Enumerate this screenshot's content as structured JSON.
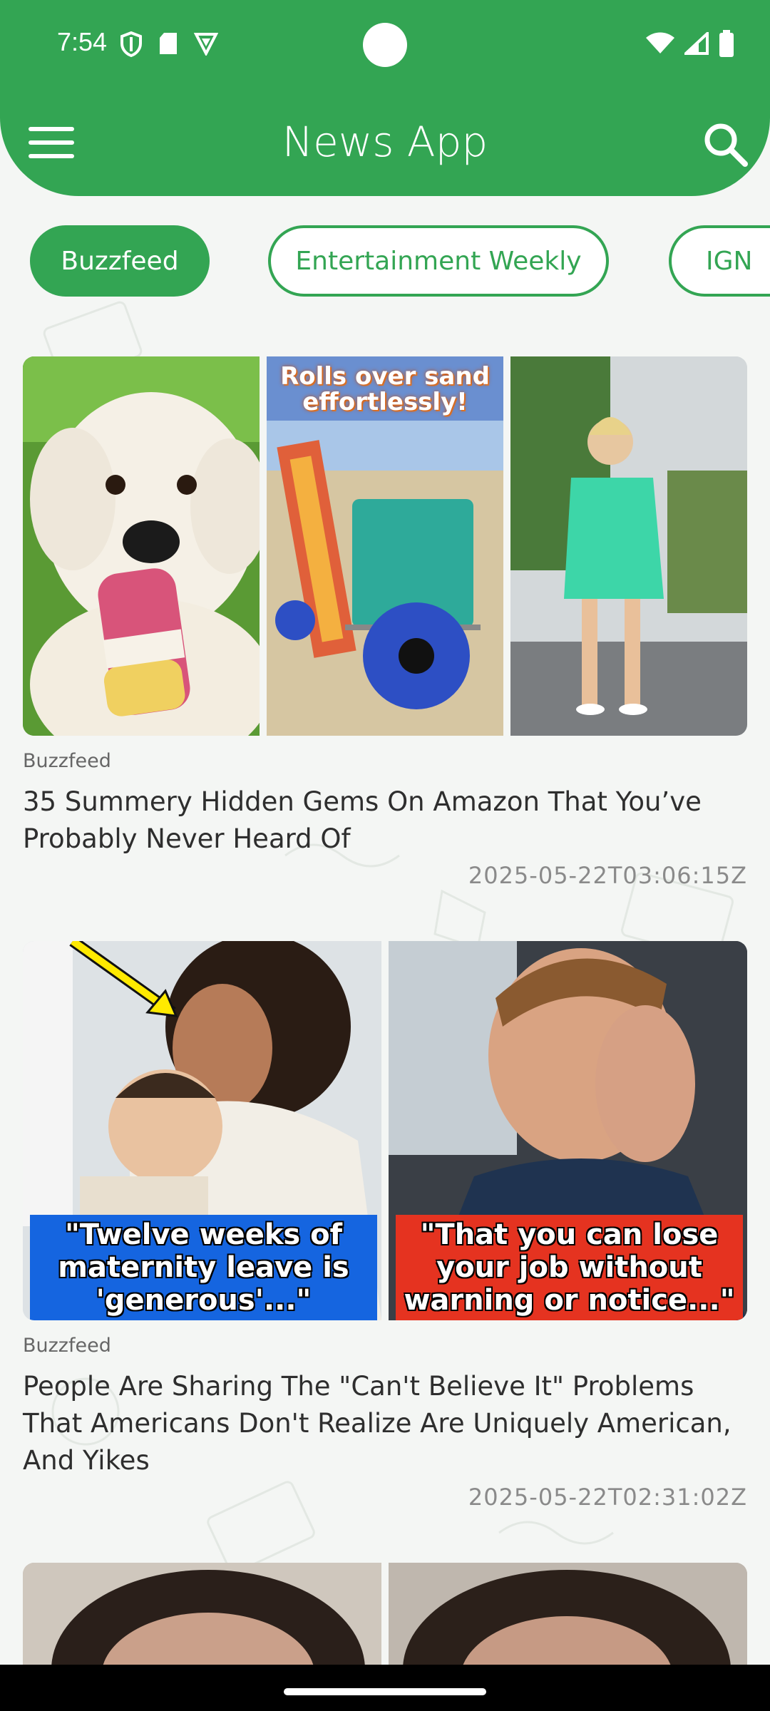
{
  "status_bar": {
    "time": "7:54",
    "left_icons": [
      "shield-icon",
      "sd-card-icon",
      "vpn-icon"
    ],
    "right_icons": [
      "wifi-icon",
      "signal-icon",
      "battery-icon"
    ]
  },
  "header": {
    "title": "News App",
    "menu_icon": "hamburger-menu-icon",
    "search_icon": "search-icon",
    "color": "#33a553"
  },
  "chips": [
    {
      "label": "Buzzfeed",
      "active": true
    },
    {
      "label": "Entertainment Weekly",
      "active": false
    },
    {
      "label": "IGN",
      "active": false
    }
  ],
  "articles": [
    {
      "source": "Buzzfeed",
      "title": "35 Summery Hidden Gems On Amazon That You’ve Probably Never Heard Of",
      "date": "2025-05-22T03:06:15Z",
      "image_overlay_text": "Rolls over sand effortlessly!"
    },
    {
      "source": "Buzzfeed",
      "title": "People Are Sharing The \"Can't Believe It\" Problems That Americans Don't Realize Are Uniquely American, And Yikes",
      "date": "2025-05-22T02:31:02Z",
      "captions": [
        "\"Twelve weeks of maternity leave is 'generous'...\"",
        "\"That you can lose your job without warning or notice...\""
      ]
    }
  ]
}
